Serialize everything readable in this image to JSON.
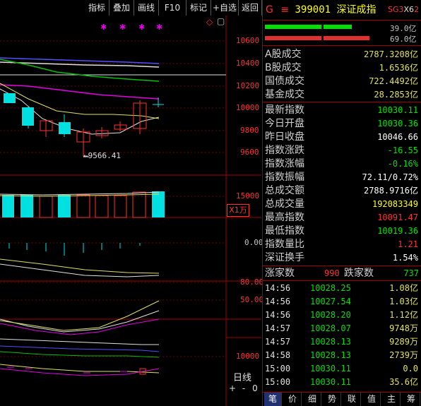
{
  "toolbar": {
    "items": [
      "指标",
      "叠加",
      "画线",
      "F10",
      "标记",
      "+自选",
      "返回"
    ]
  },
  "chart": {
    "diamond_icon": "◇",
    "box_icon": "▢",
    "price_ticks": [
      "10600",
      "10400",
      "10200",
      "10000",
      "9800",
      "9600"
    ],
    "low_marker": "9566.41",
    "vol_tick": "15000",
    "vol_unit": "X1万",
    "macd_tick": "0.00",
    "kdj_ticks": [
      "80.00",
      "50.00"
    ],
    "bottom_tick": "10000",
    "period_label": "日线",
    "zoom_in": "+",
    "zoom_out": "-",
    "nav_right": "0",
    "stars": "✱"
  },
  "index": {
    "prefix_icon": "G",
    "menu_icon": "≡",
    "code": "399001",
    "name": "深证成指",
    "badge_sg": "SG3",
    "badge_x": "X6",
    "badge_2": "2",
    "bar1_value": "39.0亿",
    "bar2_value": "69.0亿"
  },
  "turnover": [
    {
      "label": "A股成交",
      "value": "2787.3208亿"
    },
    {
      "label": "B股成交",
      "value": "1.6536亿"
    },
    {
      "label": "国债成交",
      "value": "722.4492亿"
    },
    {
      "label": "基金成交",
      "value": "28.2853亿"
    }
  ],
  "stats": [
    {
      "label": "最新指数",
      "value": "10030.11",
      "color": "#00e000"
    },
    {
      "label": "今日开盘",
      "value": "10030.36",
      "color": "#00e000"
    },
    {
      "label": "昨日收盘",
      "value": "10046.66",
      "color": "#ffffff"
    },
    {
      "label": "指数涨跌",
      "value": "-16.55",
      "color": "#00e000"
    },
    {
      "label": "指数涨幅",
      "value": "-0.16%",
      "color": "#00e000"
    },
    {
      "label": "指数振幅",
      "value": "72.11/0.72%",
      "color": "#ffffff"
    },
    {
      "label": "总成交额",
      "value": "2788.9716亿",
      "color": "#ffffff"
    },
    {
      "label": "总成交量",
      "value": "192083349",
      "color": "#ffff00"
    },
    {
      "label": "最高指数",
      "value": "10091.47",
      "color": "#ff3030"
    },
    {
      "label": "最低指数",
      "value": "10019.36",
      "color": "#00e000"
    },
    {
      "label": "指数量比",
      "value": "1.21",
      "color": "#ff3030"
    },
    {
      "label": "深证换手",
      "value": "1.54%",
      "color": "#ffffff"
    }
  ],
  "breadth": {
    "up_label": "涨家数",
    "up_value": "990",
    "down_label": "跌家数",
    "down_value": "737"
  },
  "ticks": [
    {
      "time": "14:56",
      "price": "10028.25",
      "vol": "1.08亿"
    },
    {
      "time": "14:56",
      "price": "10027.54",
      "vol": "1.03亿"
    },
    {
      "time": "14:56",
      "price": "10028.20",
      "vol": "1.12亿"
    },
    {
      "time": "14:57",
      "price": "10028.07",
      "vol": "9748万"
    },
    {
      "time": "14:57",
      "price": "10028.13",
      "vol": "9289万"
    },
    {
      "time": "14:58",
      "price": "10028.13",
      "vol": "2739万"
    },
    {
      "time": "15:00",
      "price": "10030.11",
      "vol": "0.0"
    },
    {
      "time": "15:00",
      "price": "10030.11",
      "vol": "35.6亿"
    }
  ],
  "bottom_tabs": [
    "笔",
    "价",
    "细",
    "势",
    "联",
    "值",
    "主",
    "筹"
  ]
}
